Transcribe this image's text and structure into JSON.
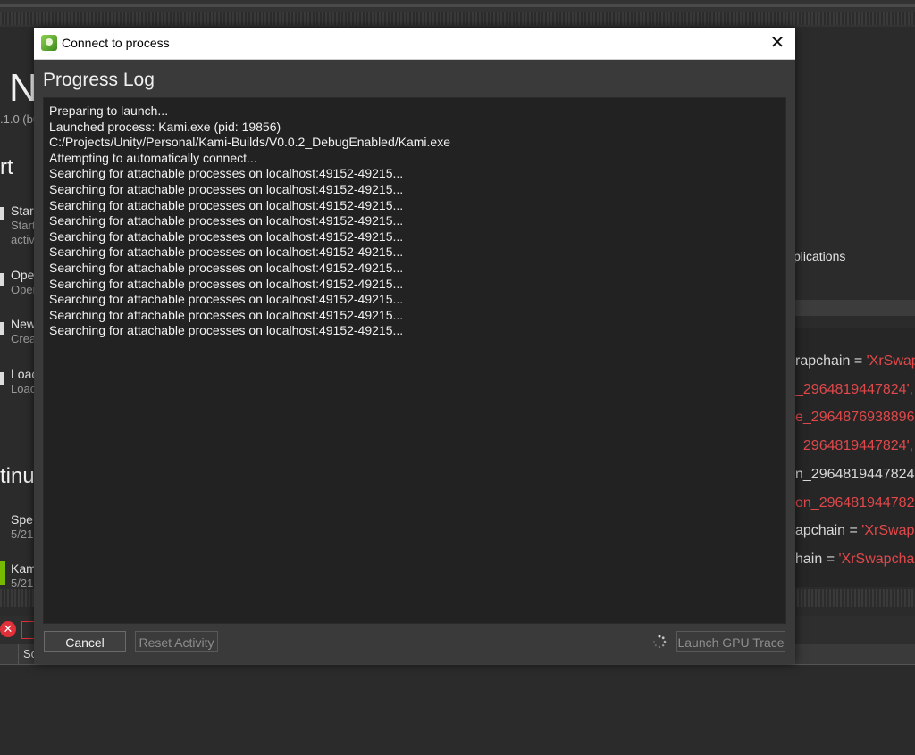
{
  "background": {
    "big_title": "N",
    "version": ".1.0 (bu",
    "start_heading": "rt",
    "continue_heading": "tinu",
    "items": [
      {
        "title": "Star",
        "subtitle": "Start",
        "subtitle2": "activ"
      },
      {
        "title": "Ope",
        "subtitle": "Oper"
      },
      {
        "title": "New",
        "subtitle": "Crea"
      },
      {
        "title": "Loac",
        "subtitle": "Loac"
      }
    ],
    "recent": [
      {
        "title": "Spe",
        "date": "5/21"
      },
      {
        "title": "Kam",
        "date": "5/21"
      }
    ],
    "applications_label": "plications",
    "code_lines": [
      {
        "w": "rapchain = ",
        "r": "'XrSwap"
      },
      {
        "w": "",
        "r": "_2964819447824', "
      },
      {
        "w": "",
        "r": "e_2964876938896"
      },
      {
        "w": "",
        "r": "_2964819447824',"
      },
      {
        "w": "n_2964819447824",
        "r": ""
      },
      {
        "w": "",
        "r": "on_296481944782"
      },
      {
        "w": "apchain = ",
        "r": "'XrSwap"
      },
      {
        "w": "hain = ",
        "r": "'XrSwapcha"
      }
    ],
    "table_col": "Sc"
  },
  "dialog": {
    "title": "Connect to process",
    "close_symbol": "✕",
    "section_title": "Progress Log",
    "log_lines": [
      "Preparing to launch...",
      "Launched process: Kami.exe (pid: 19856)",
      "C:/Projects/Unity/Personal/Kami-Builds/V0.0.2_DebugEnabled/Kami.exe",
      "Attempting to automatically connect...",
      "Searching for attachable processes on localhost:49152-49215...",
      "Searching for attachable processes on localhost:49152-49215...",
      "Searching for attachable processes on localhost:49152-49215...",
      "Searching for attachable processes on localhost:49152-49215...",
      "Searching for attachable processes on localhost:49152-49215...",
      "Searching for attachable processes on localhost:49152-49215...",
      "Searching for attachable processes on localhost:49152-49215...",
      "Searching for attachable processes on localhost:49152-49215...",
      "Searching for attachable processes on localhost:49152-49215...",
      "Searching for attachable processes on localhost:49152-49215...",
      "Searching for attachable processes on localhost:49152-49215..."
    ],
    "buttons": {
      "cancel": "Cancel",
      "reset": "Reset Activity",
      "launch": "Launch GPU Trace"
    },
    "icons": {
      "app": "nvidia-nsight-icon",
      "spinner": "loading-spinner-icon"
    }
  }
}
